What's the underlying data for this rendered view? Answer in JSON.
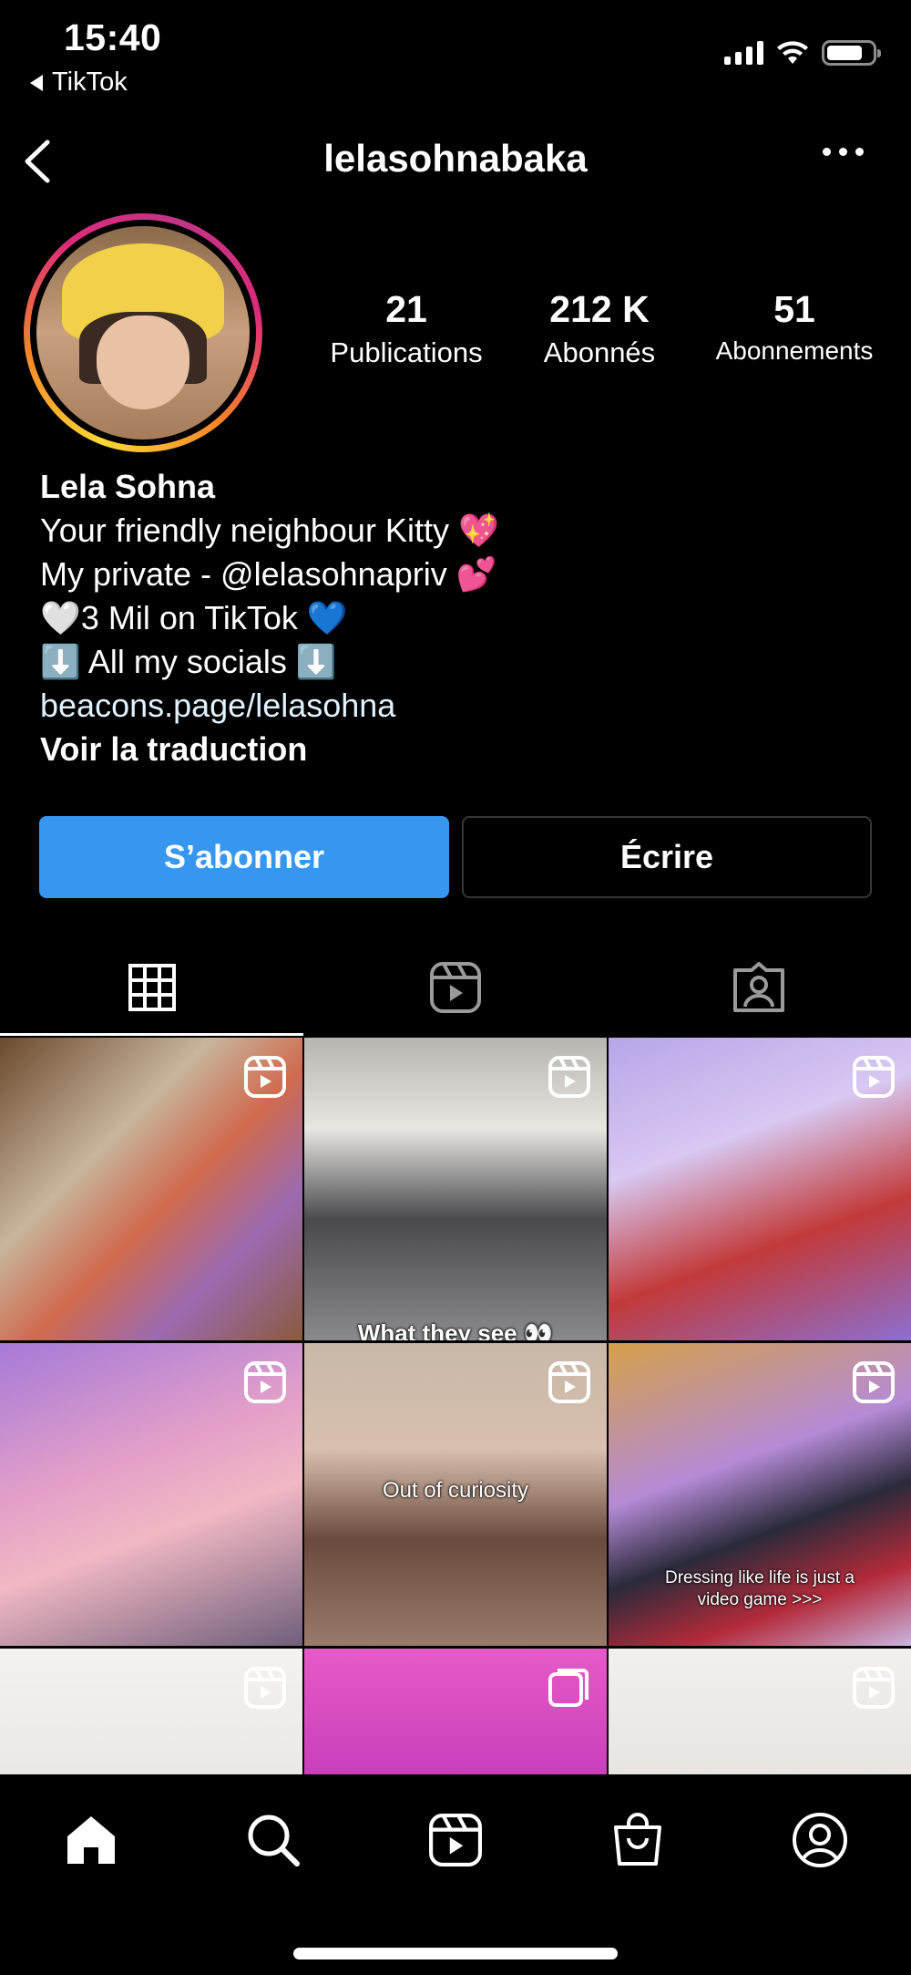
{
  "status_bar": {
    "time": "15:40",
    "back_app": "TikTok"
  },
  "header": {
    "username": "lelasohnabaka"
  },
  "profile": {
    "stats": {
      "posts_count": "21",
      "posts_label": "Publications",
      "followers_count": "212 K",
      "followers_label": "Abonnés",
      "following_count": "51",
      "following_label": "Abonnements"
    },
    "name": "Lela Sohna",
    "bio_lines": [
      "Your friendly neighbour Kitty 💖",
      "My private - @lelasohnapriv 💕",
      "🤍3 Mil on TikTok 💙",
      "⬇️ All my socials ⬇️"
    ],
    "link": "beacons.page/lelasohna",
    "translate_label": "Voir la traduction"
  },
  "buttons": {
    "follow_label": "S’abonner",
    "message_label": "Écrire",
    "follow_color": "#3797f0"
  },
  "tabs": [
    "grid-icon",
    "reels-icon",
    "tagged-icon"
  ],
  "grid": {
    "captions": {
      "cell2": "What they see 👀",
      "cell5": "Out of curiosity",
      "cell6": "Dressing like life is just a video game >>>"
    }
  },
  "bottom_nav": [
    "home-icon",
    "search-icon",
    "reels-icon",
    "shop-icon",
    "profile-icon"
  ]
}
